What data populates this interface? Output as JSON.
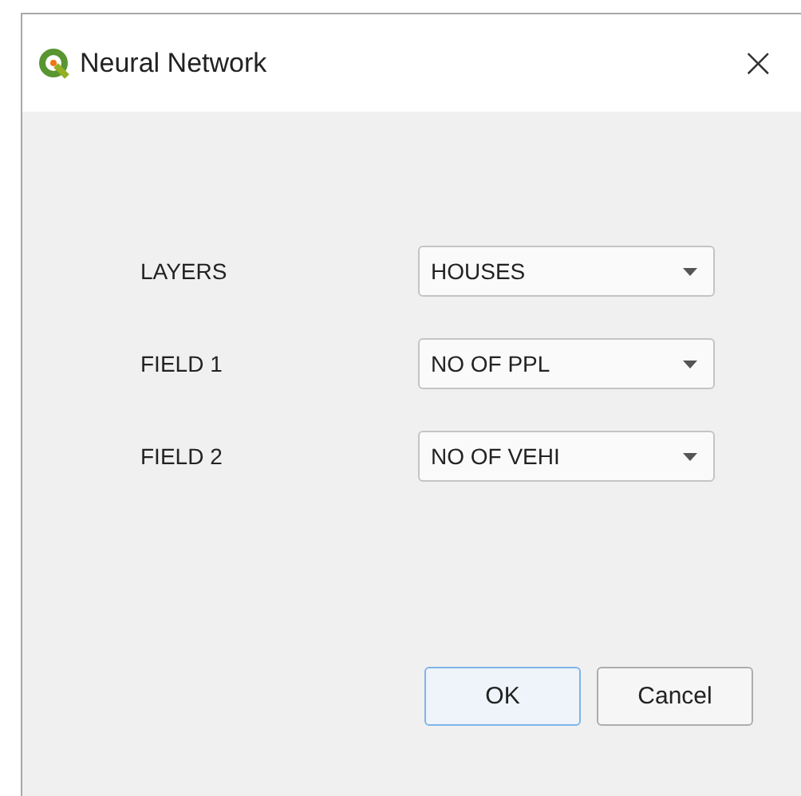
{
  "window": {
    "title": "Neural Network",
    "close": "×"
  },
  "fields": [
    {
      "label": "LAYERS",
      "value": "HOUSES"
    },
    {
      "label": "FIELD 1",
      "value": "NO OF PPL"
    },
    {
      "label": "FIELD 2",
      "value": "NO OF VEHI"
    }
  ],
  "buttons": [
    {
      "label": "OK",
      "default": true
    },
    {
      "label": "Cancel",
      "default": false
    }
  ]
}
